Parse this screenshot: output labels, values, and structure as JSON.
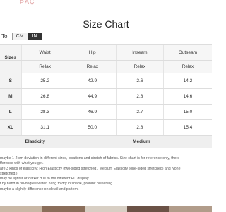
{
  "page": {
    "title": "Size Chart"
  },
  "unit_toggle": {
    "label": "To:",
    "options": [
      "CM",
      "IN"
    ],
    "selected": "IN"
  },
  "table": {
    "row_header": "Sizes",
    "columns": [
      "Waist",
      "Hip",
      "Inseam",
      "Outseam"
    ],
    "fit_label": "Relax",
    "rows": [
      {
        "size": "S",
        "values": [
          "25.2",
          "42.9",
          "2.6",
          "14.2"
        ]
      },
      {
        "size": "M",
        "values": [
          "26.8",
          "44.9",
          "2.8",
          "14.6"
        ]
      },
      {
        "size": "L",
        "values": [
          "28.3",
          "46.9",
          "2.7",
          "15.0"
        ]
      },
      {
        "size": "XL",
        "values": [
          "31.1",
          "50.0",
          "2.8",
          "15.4"
        ]
      }
    ],
    "elasticity_label": "Elasticity",
    "elasticity_value": "Medium"
  },
  "notes": [
    "maybe 1-2 cm deviation in different sizes, locations and stretch of fabrics. Size chart is for reference only, there",
    "fference with what you get.",
    "are 3 kinds of elasticity: High Elasticity (two-sided stretched), Medium Elasticity (one-sided stretched) and None",
    "stretched.)",
    "may be lighter or darker due to the different PC display.",
    "t by hand in 30-degree water, hang to dry in shade, prohibit bleaching.",
    "maybe a slightly difference on detail and pattern."
  ],
  "colors": {
    "toggle_selected_bg": "#333333",
    "header_bg": "#f6f6f6",
    "elasticity_bg": "#efefef"
  }
}
